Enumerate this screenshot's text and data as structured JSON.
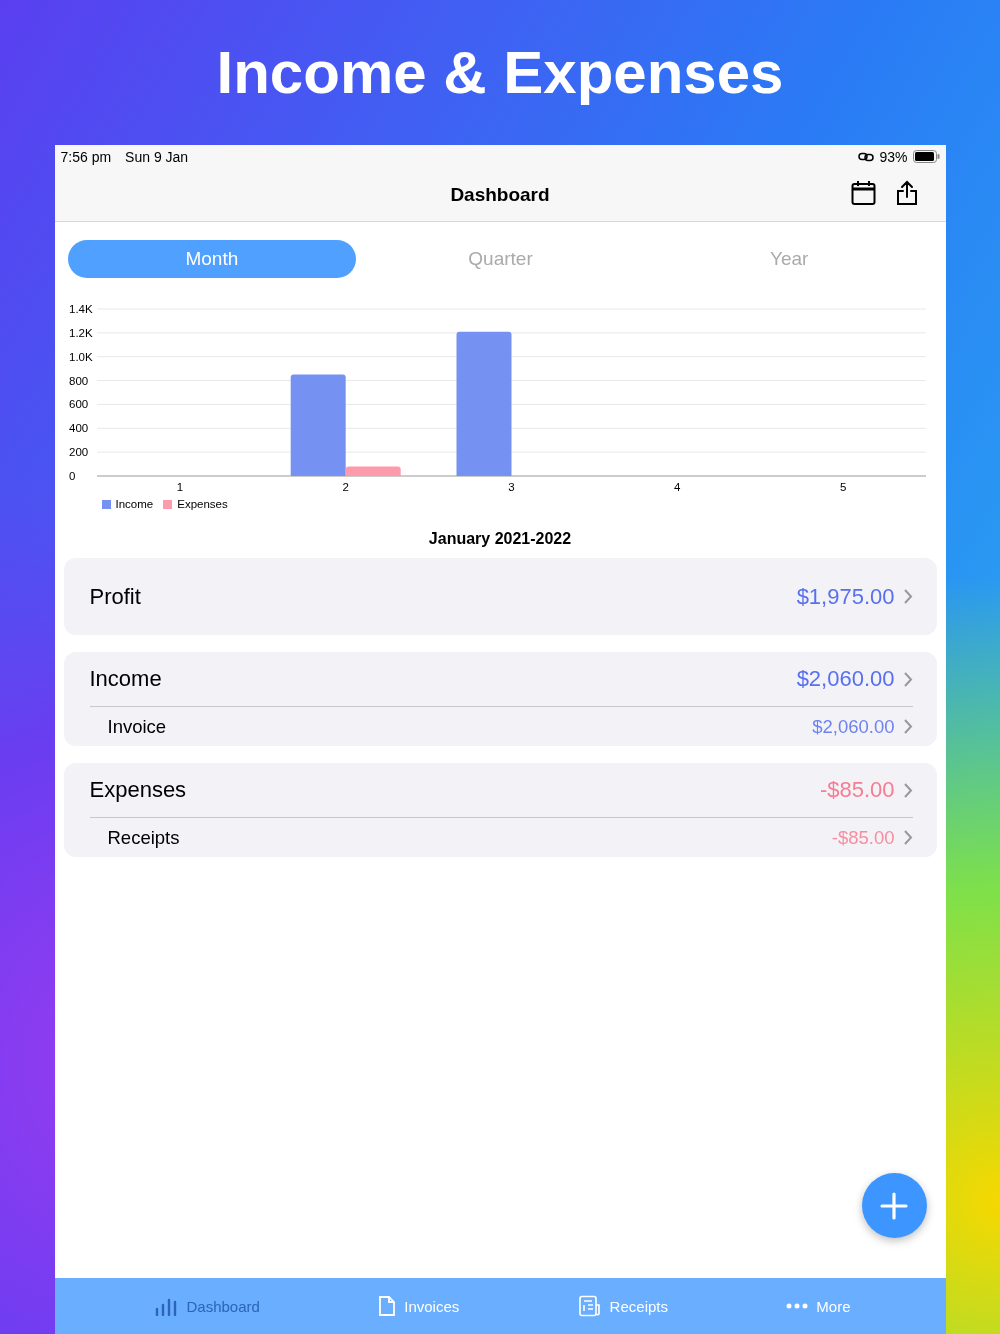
{
  "headline": "Income & Expenses",
  "status_bar": {
    "time": "7:56 pm",
    "date": "Sun 9 Jan",
    "battery": "93%"
  },
  "nav": {
    "title": "Dashboard"
  },
  "segments": [
    {
      "label": "Month",
      "selected": true
    },
    {
      "label": "Quarter",
      "selected": false
    },
    {
      "label": "Year",
      "selected": false
    }
  ],
  "chart_data": {
    "type": "bar",
    "categories": [
      "1",
      "2",
      "3",
      "4",
      "5"
    ],
    "series": [
      {
        "name": "Income",
        "color": "#7592f2",
        "values": [
          0,
          850,
          1210,
          0,
          0
        ]
      },
      {
        "name": "Expenses",
        "color": "#fd9aab",
        "values": [
          0,
          80,
          0,
          0,
          0
        ]
      }
    ],
    "grid": true,
    "ylim": [
      0,
      1400
    ],
    "yticks": [
      0,
      200,
      400,
      600,
      800,
      {
        "value": 1000,
        "label": "1.0K"
      },
      {
        "value": 1200,
        "label": "1.2K"
      },
      {
        "value": 1400,
        "label": "1.4K"
      }
    ]
  },
  "period": "January 2021-2022",
  "sections": [
    {
      "label": "Profit",
      "value": "$1,975.00",
      "color": "#5870ee"
    },
    {
      "label": "Income",
      "value": "$2,060.00",
      "color": "#5870ee",
      "rows": [
        {
          "label": "Invoice",
          "value": "$2,060.00"
        }
      ]
    },
    {
      "label": "Expenses",
      "value": "-$85.00",
      "color": "#f77d93",
      "rows": [
        {
          "label": "Receipts",
          "value": "-$85.00"
        }
      ]
    }
  ],
  "tab_bar": [
    {
      "label": "Dashboard",
      "kind": "chart",
      "selected": true
    },
    {
      "label": "Invoices",
      "kind": "document",
      "selected": false
    },
    {
      "label": "Receipts",
      "kind": "receipt",
      "selected": false
    },
    {
      "label": "More",
      "kind": "more",
      "selected": false
    }
  ]
}
